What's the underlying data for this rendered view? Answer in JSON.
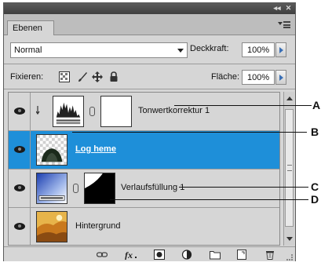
{
  "panel": {
    "tab_label": "Ebenen",
    "titlebar_buttons": {
      "collapse": "◂◂",
      "close": "✕"
    }
  },
  "blend": {
    "mode": "Normal",
    "opacity_label": "Deckkraft:",
    "opacity_value": "100%",
    "lock_label": "Fixieren:",
    "fill_label": "Fläche:",
    "fill_value": "100%"
  },
  "layers": [
    {
      "name": "Tonwertkorrektur 1",
      "type": "adjustment",
      "selected": false,
      "visible": true,
      "clipped": true
    },
    {
      "name": "Log heme",
      "type": "image",
      "selected": true,
      "visible": true,
      "clipped": false
    },
    {
      "name": "Verlaufsfüllung 1",
      "type": "gradient-fill",
      "selected": false,
      "visible": true,
      "clipped": false
    },
    {
      "name": "Hintergrund",
      "type": "background",
      "selected": false,
      "visible": true,
      "clipped": false
    }
  ],
  "callouts": [
    {
      "letter": "A"
    },
    {
      "letter": "B"
    },
    {
      "letter": "C"
    },
    {
      "letter": "D"
    }
  ],
  "colors": {
    "selection": "#1e8fd9",
    "panel_bg": "#d6d6d6",
    "titlebar": "#4a4a4a"
  }
}
